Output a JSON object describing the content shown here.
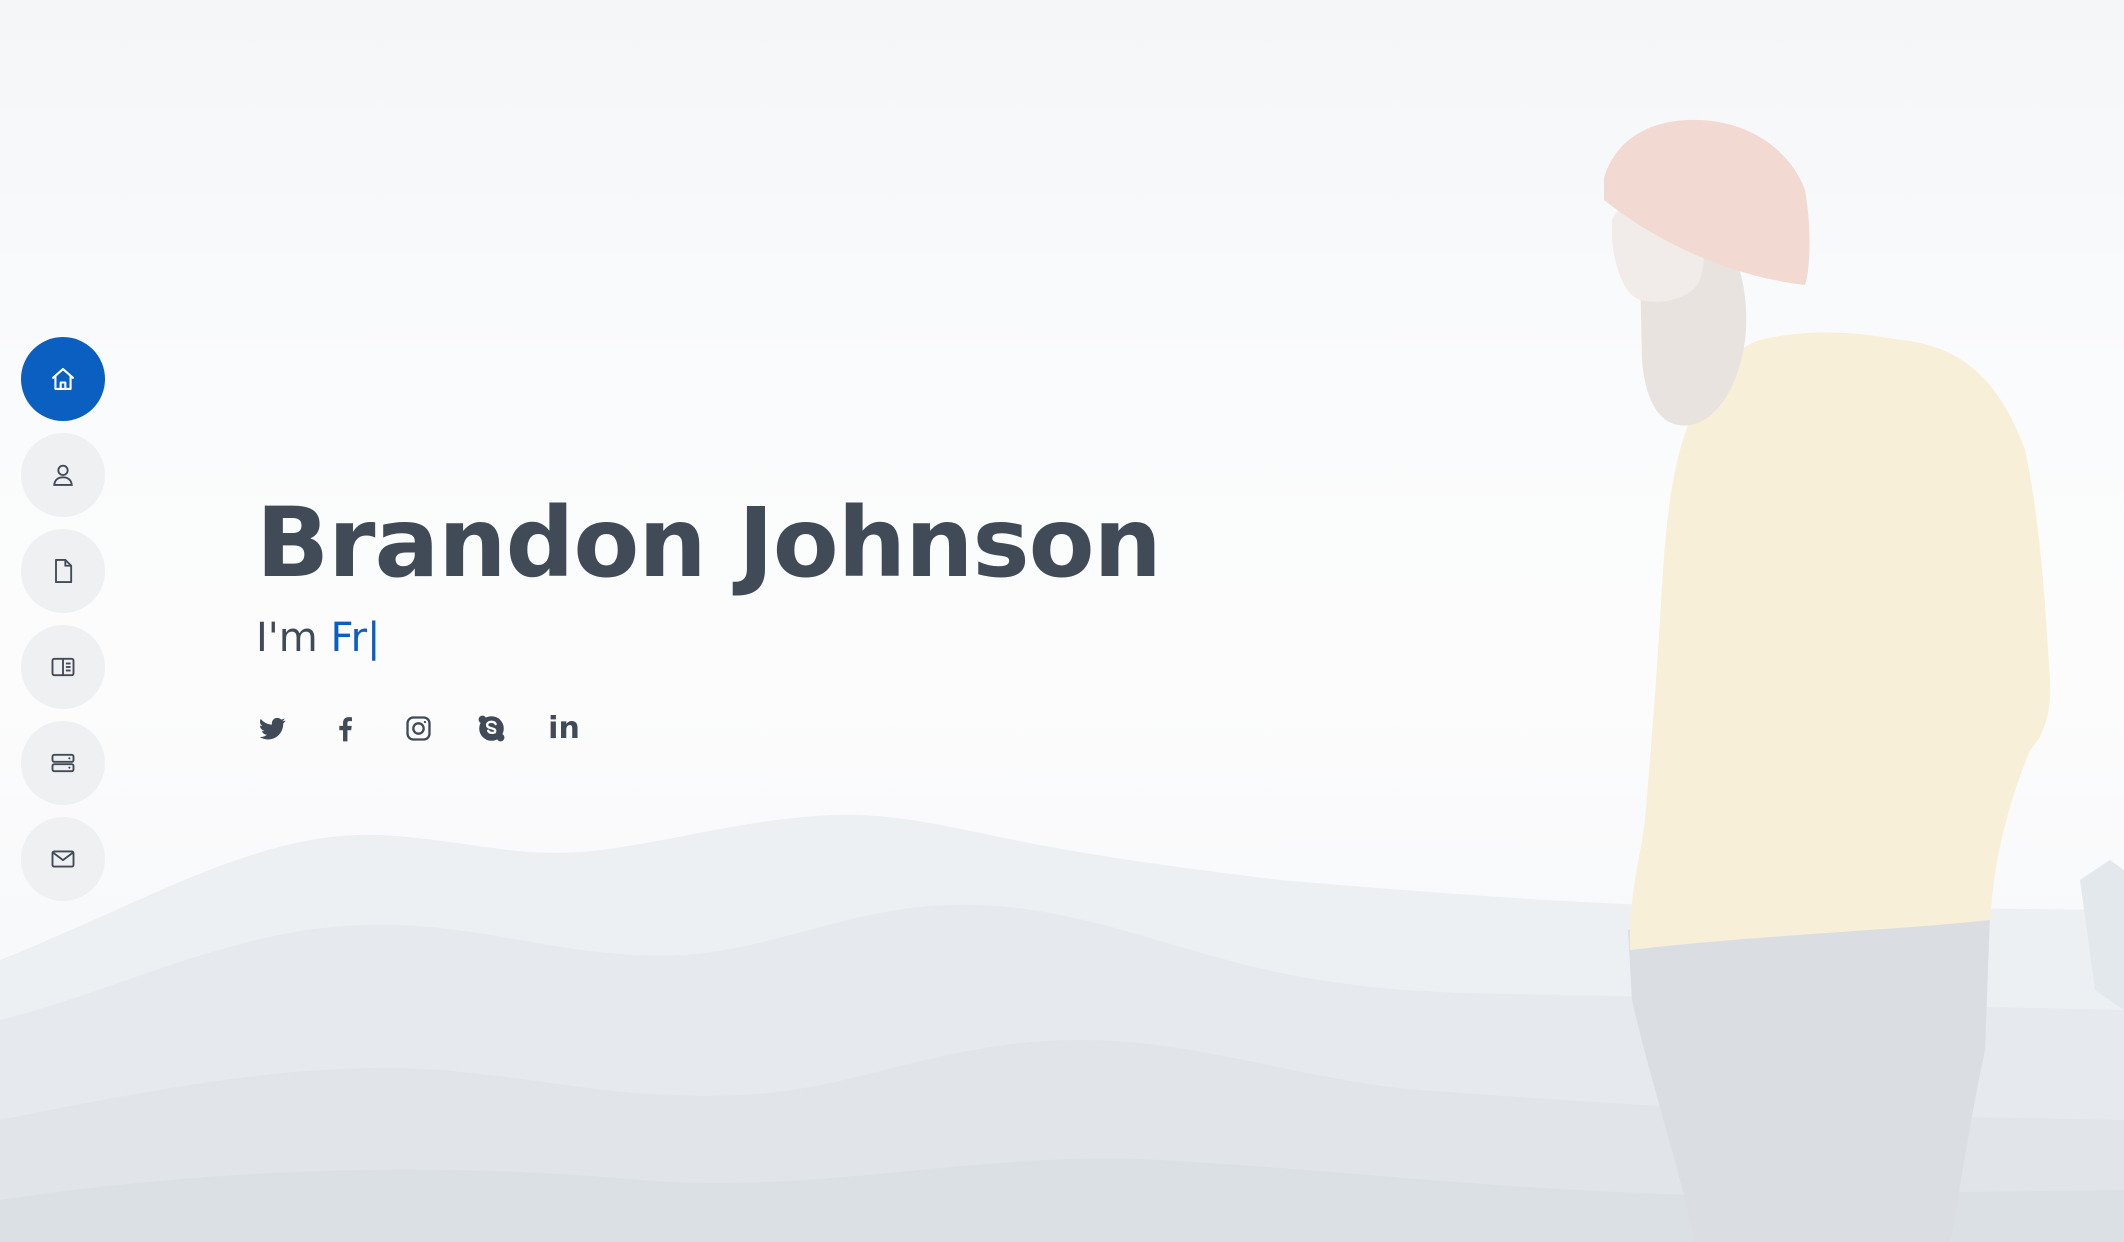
{
  "hero": {
    "name": "Brandon Johnson",
    "tagline_prefix": "I'm ",
    "typed_role": "Fr",
    "typed_cursor": "|"
  },
  "side_nav": {
    "items": [
      {
        "icon": "home-icon",
        "active": true
      },
      {
        "icon": "person-icon",
        "active": false
      },
      {
        "icon": "file-icon",
        "active": false
      },
      {
        "icon": "book-half-icon",
        "active": false
      },
      {
        "icon": "server-icon",
        "active": false
      },
      {
        "icon": "envelope-icon",
        "active": false
      }
    ]
  },
  "social": {
    "links": [
      "twitter-icon",
      "facebook-icon",
      "instagram-icon",
      "skype-icon",
      "linkedin-icon"
    ],
    "linkedin_text": "in"
  },
  "colors": {
    "accent": "#0a5fc0",
    "text": "#414b58",
    "nav_bg": "#eef0f2"
  }
}
